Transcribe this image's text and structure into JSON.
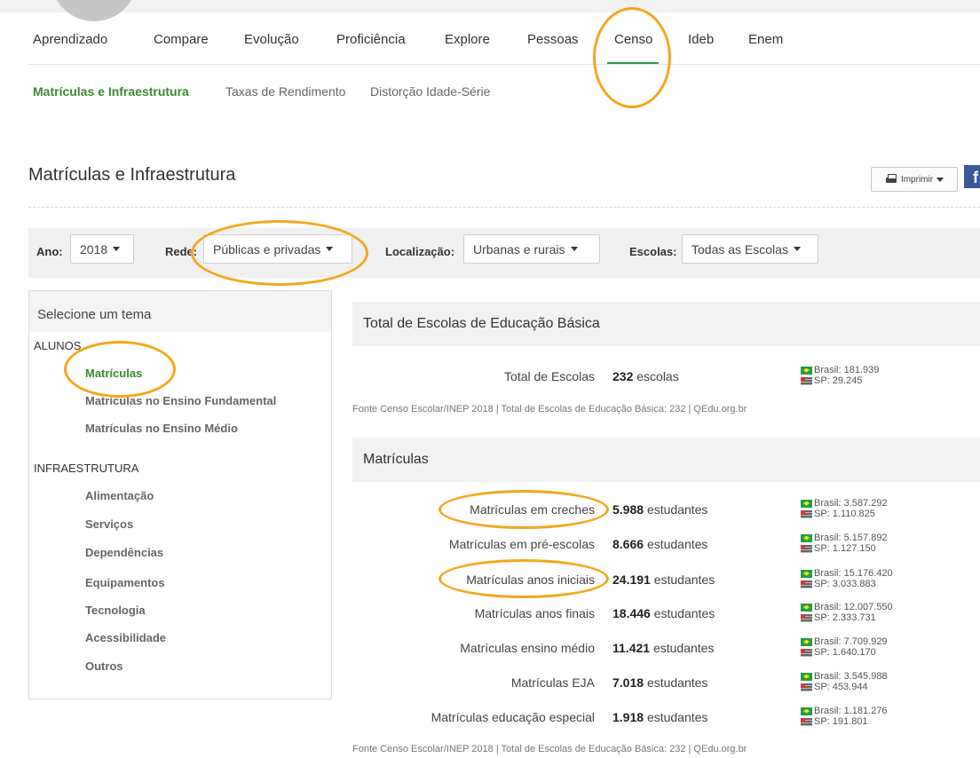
{
  "nav": {
    "items": [
      {
        "label": "Aprendizado"
      },
      {
        "label": "Compare"
      },
      {
        "label": "Evolução"
      },
      {
        "label": "Proficiência"
      },
      {
        "label": "Explore"
      },
      {
        "label": "Pessoas"
      },
      {
        "label": "Censo",
        "active": true
      },
      {
        "label": "Ideb"
      },
      {
        "label": "Enem"
      }
    ]
  },
  "subnav": {
    "items": [
      {
        "label": "Matrículas e Infraestrutura",
        "active": true
      },
      {
        "label": "Taxas de Rendimento"
      },
      {
        "label": "Distorção Idade-Série"
      }
    ]
  },
  "page": {
    "title": "Matrículas e Infraestrutura",
    "print_label": "Imprimir",
    "fb_label": "f"
  },
  "filters": {
    "ano": {
      "label": "Ano:",
      "value": "2018"
    },
    "rede": {
      "label": "Rede:",
      "value": "Públicas e privadas"
    },
    "localizacao": {
      "label": "Localização:",
      "value": "Urbanas e rurais"
    },
    "escolas": {
      "label": "Escolas:",
      "value": "Todas as Escolas"
    }
  },
  "sidebar": {
    "header": "Selecione um tema",
    "sections": [
      {
        "title": "ALUNOS",
        "items": [
          "Matrículas",
          "Matrículas no Ensino Fundamental",
          "Matrículas no Ensino Médio"
        ]
      },
      {
        "title": "INFRAESTRUTURA",
        "items": [
          "Alimentação",
          "Serviços",
          "Dependências",
          "Equipamentos",
          "Tecnologia",
          "Acessibilidade",
          "Outros"
        ]
      }
    ]
  },
  "escolas_panel": {
    "title": "Total de Escolas de Educação Básica",
    "row": {
      "label": "Total de Escolas",
      "value": "232",
      "unit": "escolas",
      "brasil": "Brasil: 181.939",
      "sp": "SP: 29.245"
    },
    "source": "Fonte Censo Escolar/INEP 2018 | Total de Escolas de Educação Básica: 232 | QEdu.org.br"
  },
  "matriculas_panel": {
    "title": "Matrículas",
    "rows": [
      {
        "label": "Matrículas em creches",
        "value": "5.988",
        "unit": "estudantes",
        "brasil": "Brasil: 3.587.292",
        "sp": "SP: 1.110.825"
      },
      {
        "label": "Matrículas em pré-escolas",
        "value": "8.666",
        "unit": "estudantes",
        "brasil": "Brasil: 5.157.892",
        "sp": "SP: 1.127.150"
      },
      {
        "label": "Matrículas anos iniciais",
        "value": "24.191",
        "unit": "estudantes",
        "brasil": "Brasil: 15.176.420",
        "sp": "SP: 3.033.883"
      },
      {
        "label": "Matrículas anos finais",
        "value": "18.446",
        "unit": "estudantes",
        "brasil": "Brasil: 12.007.550",
        "sp": "SP: 2.333.731"
      },
      {
        "label": "Matrículas ensino médio",
        "value": "11.421",
        "unit": "estudantes",
        "brasil": "Brasil: 7.709.929",
        "sp": "SP: 1.640.170"
      },
      {
        "label": "Matrículas EJA",
        "value": "7.018",
        "unit": "estudantes",
        "brasil": "Brasil: 3.545.988",
        "sp": "SP: 453.944"
      },
      {
        "label": "Matrículas educação especial",
        "value": "1.918",
        "unit": "estudantes",
        "brasil": "Brasil: 1.181.276",
        "sp": "SP: 191.801"
      }
    ],
    "source": "Fonte Censo Escolar/INEP 2018 | Total de Escolas de Educação Básica: 232 | QEdu.org.br"
  },
  "colors": {
    "active_green": "#3a8a2e",
    "annotation_orange": "#f3a81d"
  }
}
